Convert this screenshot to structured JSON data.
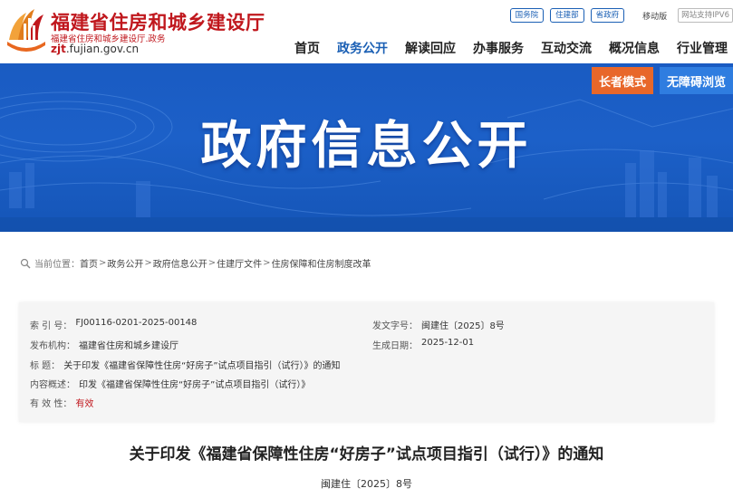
{
  "header": {
    "site_title": "福建省住房和城乡建设厅",
    "site_sub": "福建省住房和城乡建设厅.政务",
    "domain_strong": "zjt",
    "domain_rest": ".fujian.gov.cn",
    "links": [
      "国务院",
      "住建部",
      "省政府"
    ],
    "mobile": "移动版",
    "ipv6": "网站支持IPV6"
  },
  "nav": [
    "首页",
    "政务公开",
    "解读回应",
    "办事服务",
    "互动交流",
    "概况信息",
    "行业管理"
  ],
  "banner": {
    "title": "政府信息公开",
    "elder_mode": "长者模式",
    "accessible": "无障碍浏览"
  },
  "breadcrumb": {
    "prefix": "当前位置：",
    "items": [
      "首页",
      "政务公开",
      "政府信息公开",
      "住建厅文件",
      "住房保障和住房制度改革"
    ]
  },
  "info": {
    "index_label": "索  引  号：",
    "index_value": "FJ00116-0201-2025-00148",
    "doc_no_label": "发文字号：",
    "doc_no_value": "闽建住〔2025〕8号",
    "org_label": "发布机构：",
    "org_value": "福建省住房和城乡建设厅",
    "date_label": "生成日期：",
    "date_value": "2025-12-01",
    "subject_label": "标      题：",
    "subject_value": "关于印发《福建省保障性住房“好房子”试点项目指引（试行）》的通知",
    "summary_label": "内容概述：",
    "summary_value": "印发《福建省保障性住房“好房子”试点项目指引（试行）》",
    "validity_label": "有  效  性：",
    "validity_value": "有效"
  },
  "article": {
    "title": "关于印发《福建省保障性住房“好房子”试点项目指引（试行）》的通知",
    "doc_number": "闽建住〔2025〕8号"
  },
  "colors": {
    "brand_red": "#c0171d",
    "nav_active": "#1a5fb4",
    "banner_blue": "#1c60c8",
    "elder_orange": "#e8672a",
    "access_blue": "#2f7de0"
  }
}
